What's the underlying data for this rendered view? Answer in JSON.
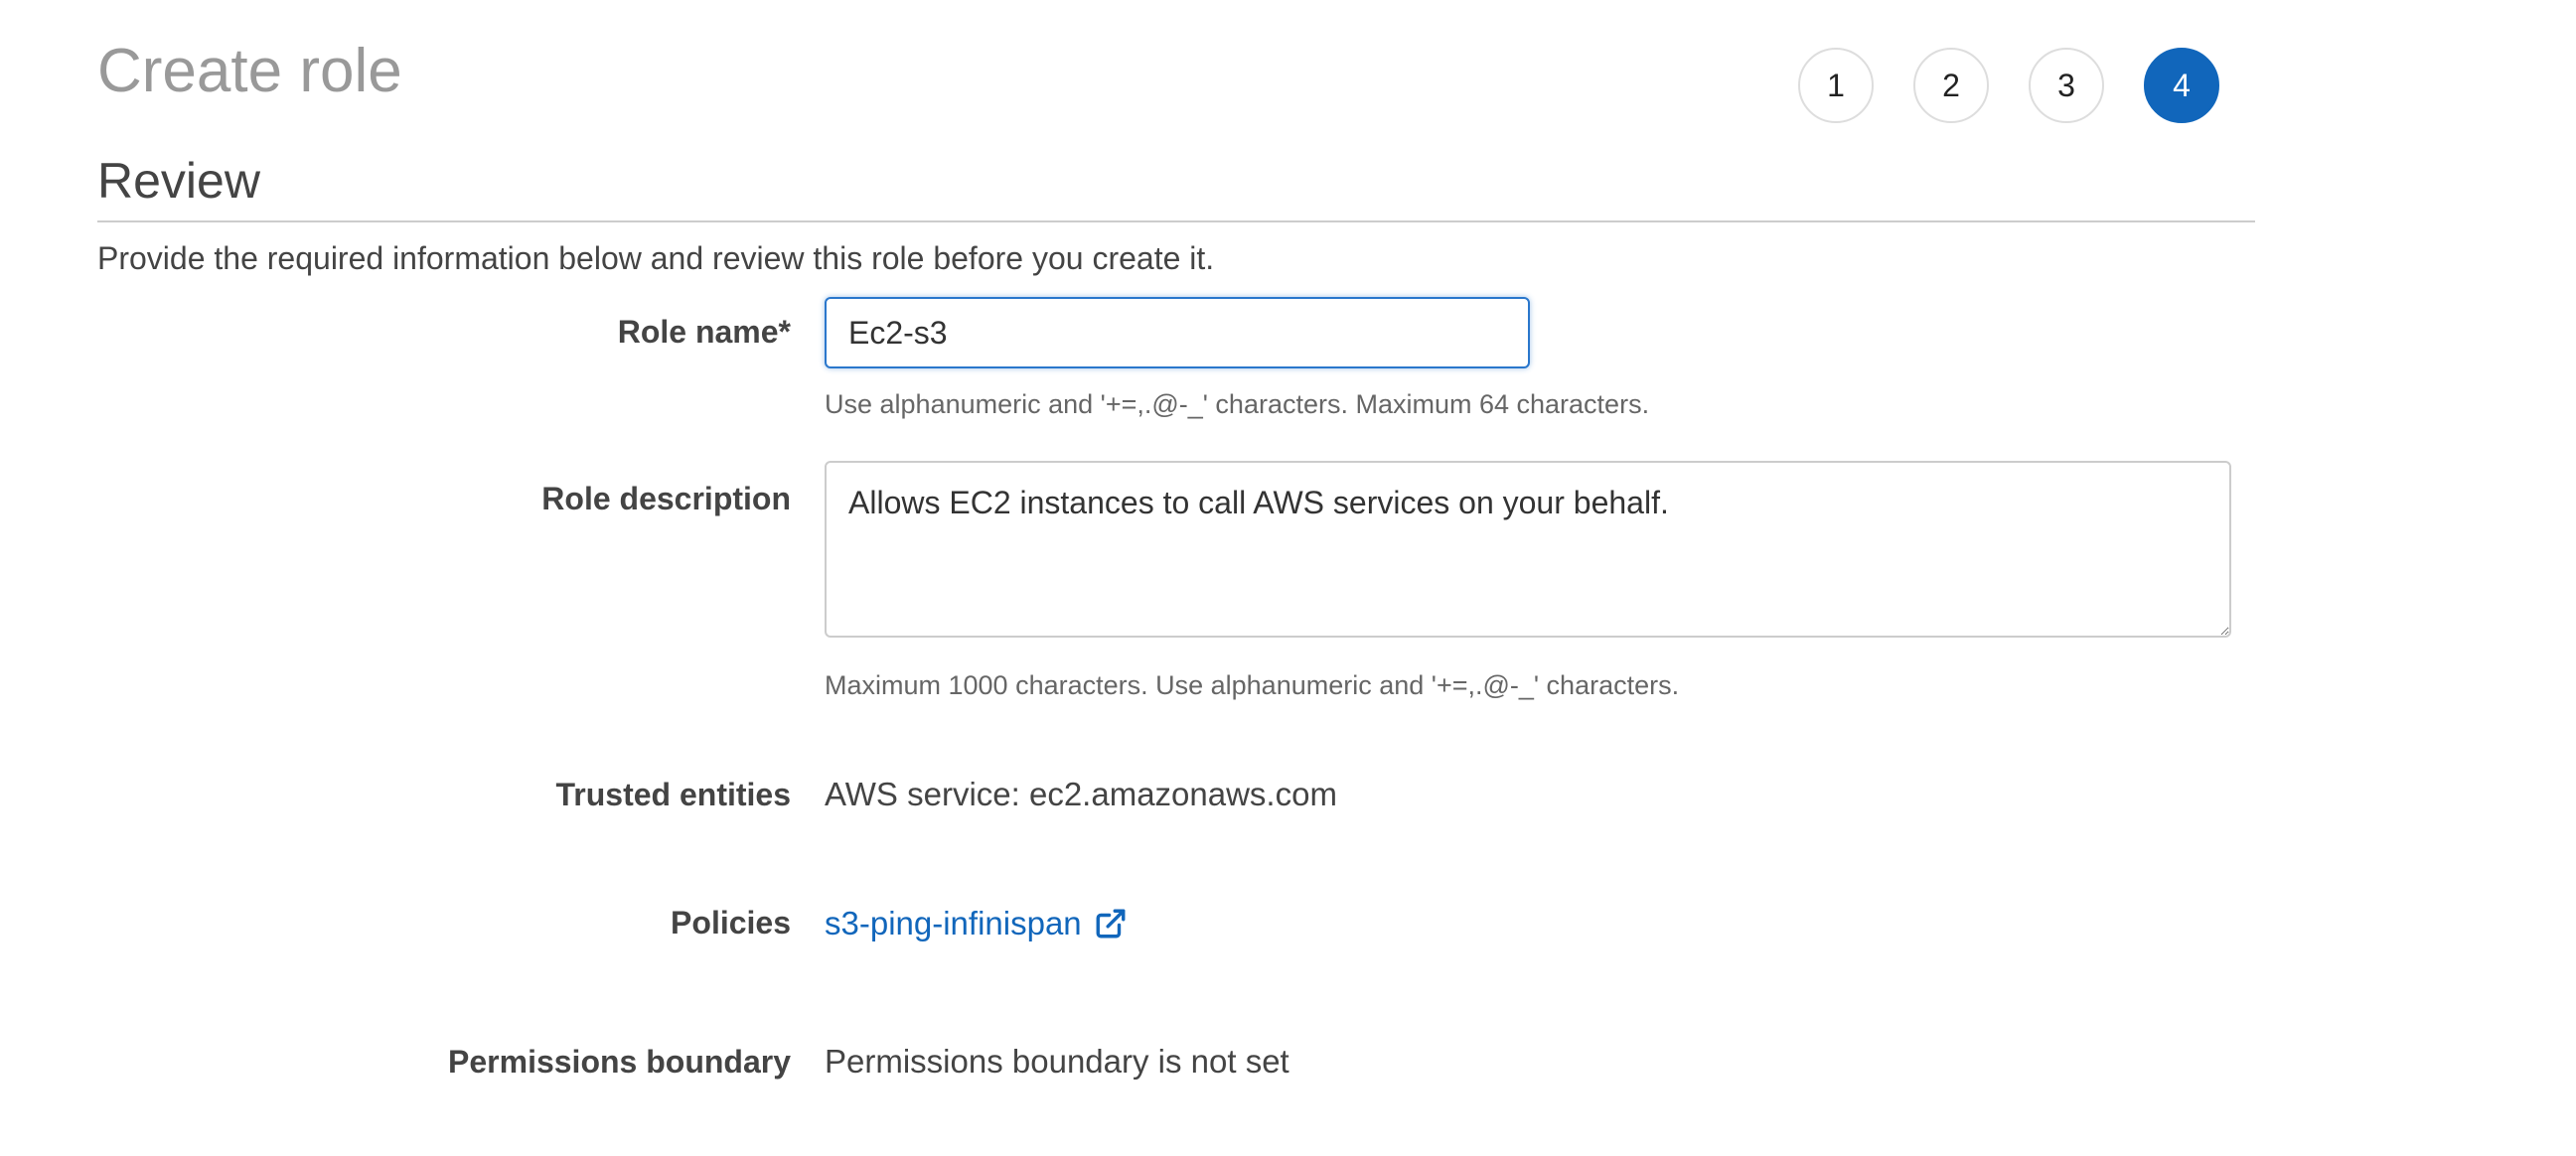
{
  "page": {
    "title": "Create role"
  },
  "steps": [
    "1",
    "2",
    "3",
    "4"
  ],
  "active_step": "4",
  "review": {
    "title": "Review",
    "intro": "Provide the required information below and review this role before you create it."
  },
  "role_name": {
    "label": "Role name*",
    "value": "Ec2-s3",
    "hint": "Use alphanumeric and '+=,.@-_' characters. Maximum 64 characters."
  },
  "role_description": {
    "label": "Role description",
    "value": "Allows EC2 instances to call AWS services on your behalf.",
    "hint": "Maximum 1000 characters. Use alphanumeric and '+=,.@-_' characters."
  },
  "trusted_entities": {
    "label": "Trusted entities",
    "value": "AWS service: ec2.amazonaws.com"
  },
  "policies": {
    "label": "Policies",
    "link_text": "s3-ping-infinispan",
    "icon": "external-link-icon"
  },
  "permissions_boundary": {
    "label": "Permissions boundary",
    "value": "Permissions boundary is not set"
  },
  "colors": {
    "accent": "#1166bb",
    "title_gray": "#999999",
    "text": "#444444",
    "focus_border": "#2a77cc"
  }
}
